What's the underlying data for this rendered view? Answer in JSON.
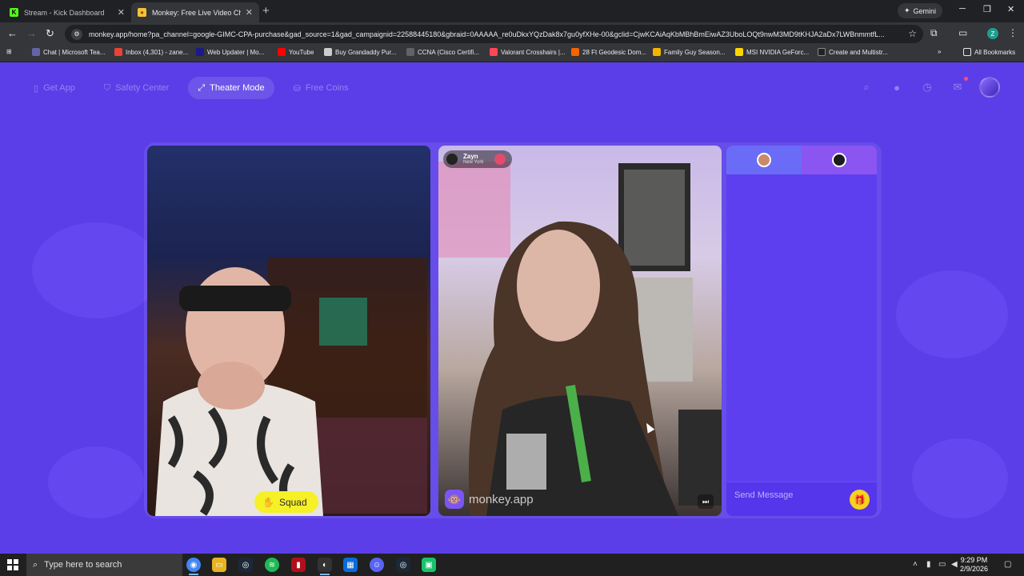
{
  "browser": {
    "tabs": [
      {
        "title": "Stream - Kick Dashboard",
        "favicon_color": "#53fc18",
        "favicon_letter": "K"
      },
      {
        "title": "Monkey: Free Live Video Ch",
        "favicon_color": "#f6c23a",
        "favicon_letter": "●"
      }
    ],
    "gemini_label": "Gemini",
    "url": "monkey.app/home?pa_channel=google-GIMC-CPA-purchase&gad_source=1&gad_campaignid=22588445180&gbraid=0AAAAA_re0uDkxYQzDak8x7gu0yfXHe-00&gclid=CjwKCAiAqKbMBhBmEiwAZ3UboLOQt9nwM3MD9tKHJA2aDx7LWBnmmtfL...",
    "profile_letter": "Z",
    "bookmarks": [
      {
        "label": "Chat | Microsoft Tea...",
        "color": "#6264a7"
      },
      {
        "label": "Inbox (4,301) - zane...",
        "color": "#ea4335"
      },
      {
        "label": "Web Updater | Mo...",
        "color": "#1a1a8a"
      },
      {
        "label": "YouTube",
        "color": "#ff0000"
      },
      {
        "label": "Buy Grandaddy Pur...",
        "color": "#cccccc"
      },
      {
        "label": "CCNA (Cisco Certifi...",
        "color": "#35363a"
      },
      {
        "label": "Valorant Crosshairs |...",
        "color": "#ff4655"
      },
      {
        "label": "28 Ft Geodesic Dom...",
        "color": "#f56400"
      },
      {
        "label": "Family Guy Season...",
        "color": "#f4b400"
      },
      {
        "label": "MSI NVIDIA GeForc...",
        "color": "#ffd600"
      },
      {
        "label": "Create and Multistr...",
        "color": "#222222"
      }
    ],
    "all_bookmarks": "All Bookmarks"
  },
  "app": {
    "nav": {
      "get_app": "Get App",
      "safety_center": "Safety Center",
      "theater_mode": "Theater Mode",
      "free_coins": "Free Coins"
    },
    "left_video": {
      "badge": "Squad"
    },
    "mid_video": {
      "user_name": "Zayn",
      "user_location": "New York",
      "watermark": "monkey.app"
    },
    "chat": {
      "placeholder": "Send Message"
    }
  },
  "taskbar": {
    "search_placeholder": "Type here to search",
    "time": "9:29 PM",
    "date": "2/9/2026"
  },
  "colors": {
    "brand_purple": "#5b3ee8",
    "squad_yellow": "#f6f027",
    "gift_yellow": "#f6d31a"
  }
}
